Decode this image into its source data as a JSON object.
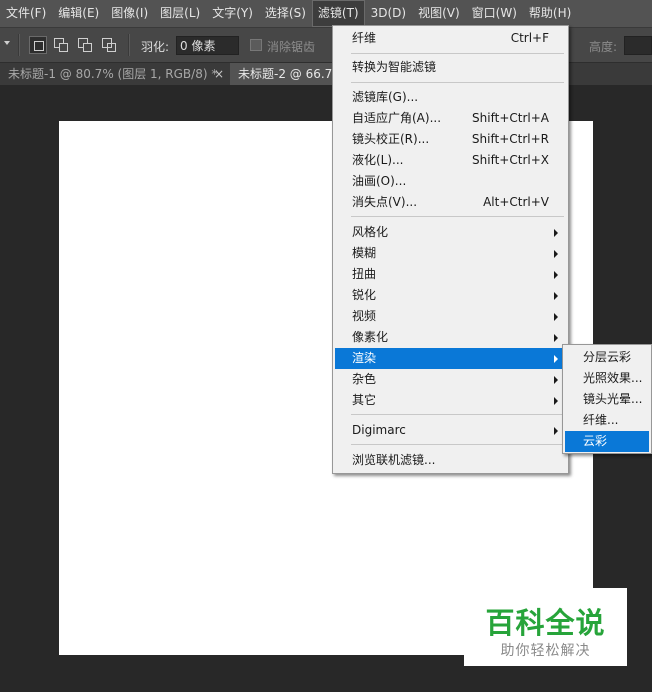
{
  "menubar": {
    "items": [
      "文件(F)",
      "编辑(E)",
      "图像(I)",
      "图层(L)",
      "文字(Y)",
      "选择(S)",
      "滤镜(T)",
      "3D(D)",
      "视图(V)",
      "窗口(W)",
      "帮助(H)"
    ],
    "active": "滤镜(T)"
  },
  "options_bar": {
    "feather_label": "羽化:",
    "feather_value": "0 像素",
    "antialias_label": "消除锯齿",
    "height_label": "高度:"
  },
  "tabs": {
    "tab1": "未标题-1 @ 80.7% (图层 1, RGB/8) *",
    "tab1_close": "×",
    "tab2": "未标题-2 @ 66.7"
  },
  "filter_menu": {
    "items": [
      {
        "label": "纤维",
        "shortcut": "Ctrl+F"
      },
      {
        "label": "转换为智能滤镜"
      },
      {
        "label": "滤镜库(G)..."
      },
      {
        "label": "自适应广角(A)...",
        "shortcut": "Shift+Ctrl+A"
      },
      {
        "label": "镜头校正(R)...",
        "shortcut": "Shift+Ctrl+R"
      },
      {
        "label": "液化(L)...",
        "shortcut": "Shift+Ctrl+X"
      },
      {
        "label": "油画(O)..."
      },
      {
        "label": "消失点(V)...",
        "shortcut": "Alt+Ctrl+V"
      },
      {
        "label": "风格化",
        "submenu": true
      },
      {
        "label": "模糊",
        "submenu": true
      },
      {
        "label": "扭曲",
        "submenu": true
      },
      {
        "label": "锐化",
        "submenu": true
      },
      {
        "label": "视频",
        "submenu": true
      },
      {
        "label": "像素化",
        "submenu": true
      },
      {
        "label": "渲染",
        "submenu": true,
        "highlighted": true
      },
      {
        "label": "杂色",
        "submenu": true
      },
      {
        "label": "其它",
        "submenu": true
      },
      {
        "label": "Digimarc",
        "submenu": true
      },
      {
        "label": "浏览联机滤镜..."
      }
    ]
  },
  "render_submenu": {
    "items": [
      {
        "label": "分层云彩"
      },
      {
        "label": "光照效果..."
      },
      {
        "label": "镜头光晕..."
      },
      {
        "label": "纤维..."
      },
      {
        "label": "云彩",
        "highlighted": true
      }
    ]
  },
  "watermark": {
    "title": "百科全说",
    "subtitle": "助你轻松解决"
  },
  "colors": {
    "highlight": "#0a78d7",
    "watermark_green": "#27a43a",
    "menu_bg": "#f0f0f0",
    "app_bg": "#282828"
  }
}
